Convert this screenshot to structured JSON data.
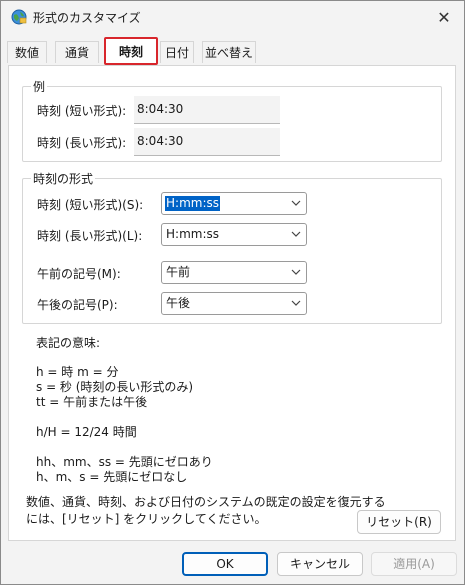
{
  "window": {
    "title": "形式のカスタマイズ",
    "close_glyph": "✕"
  },
  "tabs": [
    {
      "label": "数値"
    },
    {
      "label": "通貨"
    },
    {
      "label": "時刻"
    },
    {
      "label": "日付"
    },
    {
      "label": "並べ替え"
    }
  ],
  "active_tab": "時刻",
  "example": {
    "group_label": "例",
    "short_label": "時刻 (短い形式):",
    "short_value": "8:04:30",
    "long_label": "時刻 (長い形式):",
    "long_value": "8:04:30"
  },
  "format": {
    "group_label": "時刻の形式",
    "short_label": "時刻 (短い形式)(S):",
    "short_value": "H:mm:ss",
    "long_label": "時刻 (長い形式)(L):",
    "long_value": "H:mm:ss",
    "am_label": "午前の記号(M):",
    "am_value": "午前",
    "pm_label": "午後の記号(P):",
    "pm_value": "午後"
  },
  "notation": {
    "heading": "表記の意味:",
    "line1": "h = 時   m = 分",
    "line2": "s = 秒 (時刻の長い形式のみ)",
    "line3": "tt = 午前または午後",
    "line4": "h/H = 12/24 時間",
    "line5": "hh、mm、ss = 先頭にゼロあり",
    "line6": "h、m、s = 先頭にゼロなし"
  },
  "reset": {
    "text1": "数値、通貨、時刻、および日付のシステムの既定の設定を復元する",
    "text2": "には、[リセット] をクリックしてください。",
    "button": "リセット(R)"
  },
  "footer": {
    "ok": "OK",
    "cancel": "キャンセル",
    "apply": "適用(A)"
  },
  "colors": {
    "active_tab_highlight": "#d8262c",
    "selection": "#0063c7",
    "ok_border": "#005fb8"
  },
  "icons": {
    "title": "globe-icon",
    "dropdown": "chevron-down-icon",
    "close": "close-icon"
  }
}
